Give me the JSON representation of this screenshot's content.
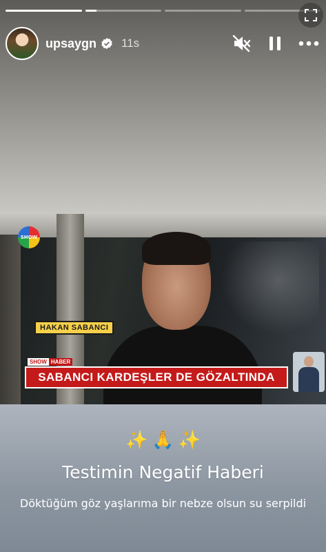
{
  "story": {
    "progress": [
      1.0,
      0.15,
      0.0,
      0.0
    ],
    "username": "upsaygn",
    "verified": true,
    "time": "11s",
    "icons": {
      "fullscreen": "fullscreen-icon",
      "mute": "muted-speaker-icon",
      "pause": "pause-icon",
      "more": "more-horizontal-icon",
      "verified": "verified-badge-icon"
    }
  },
  "video": {
    "channel_logo": "SHOW",
    "name_tag": "HAKAN SABANCI",
    "news_label_a": "SHOW",
    "news_label_b": "HABER",
    "headline": "SABANCI KARDEŞLER DE GÖZALTINDA"
  },
  "caption": {
    "emoji": [
      "✨",
      "🙏",
      "✨"
    ],
    "title": "Testimin Negatif Haberi",
    "subtitle": "Döktüğüm göz yaşlarıma bir nebze olsun su serpildi"
  },
  "colors": {
    "ticker_red": "#c41a1a",
    "name_tag_yellow": "#f6d04a"
  }
}
